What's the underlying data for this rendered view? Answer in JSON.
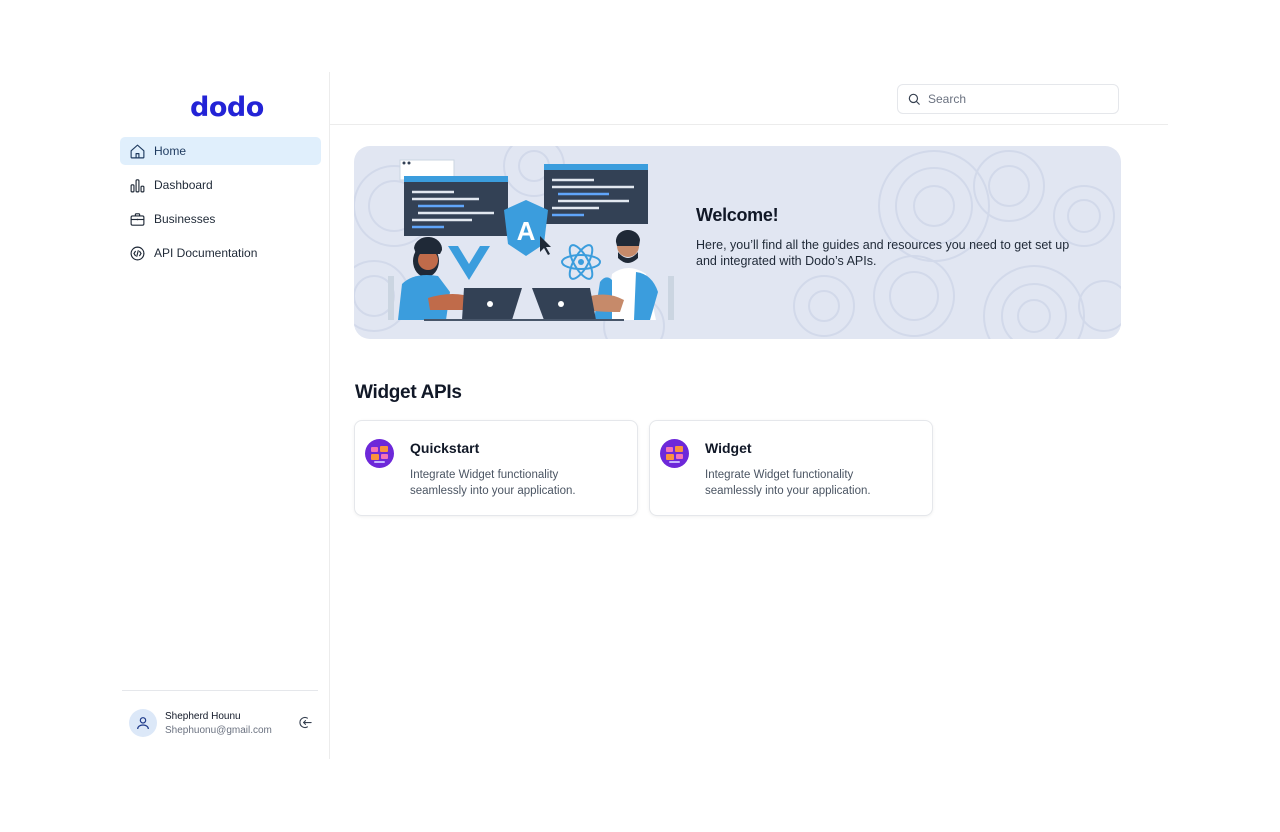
{
  "sidebar": {
    "logo": "dodo",
    "items": [
      {
        "label": "Home",
        "icon": "home-icon",
        "active": true
      },
      {
        "label": "Dashboard",
        "icon": "bar-chart-icon",
        "active": false
      },
      {
        "label": "Businesses",
        "icon": "briefcase-icon",
        "active": false
      },
      {
        "label": "API Documentation",
        "icon": "api-doc-icon",
        "active": false
      }
    ],
    "user": {
      "name": "Shepherd Hounu",
      "email": "Shephuonu@gmail.com",
      "avatar_icon": "user-icon",
      "logout_icon": "logout-icon"
    }
  },
  "header": {
    "search": {
      "placeholder": "Search",
      "value": "",
      "icon": "search-icon"
    }
  },
  "banner": {
    "title": "Welcome!",
    "text": "Here, you’ll find all the guides and resources you need to get set up and integrated with Dodo’s APIs.",
    "illustration": "developers-coding-illustration",
    "badge_letter": "A"
  },
  "widgets": {
    "section_title": "Widget APIs",
    "cards": [
      {
        "title": "Quickstart",
        "description": "Integrate Widget functionality seamlessly into your application.",
        "icon": "widget-app-icon"
      },
      {
        "title": "Widget",
        "description": "Integrate Widget functionality seamlessly into your application.",
        "icon": "widget-app-icon"
      }
    ]
  },
  "colors": {
    "brand": "#2323d6",
    "active_nav_bg": "#e0effc",
    "banner_bg": "#e1e6f2",
    "card_icon": "#7c3aed"
  }
}
